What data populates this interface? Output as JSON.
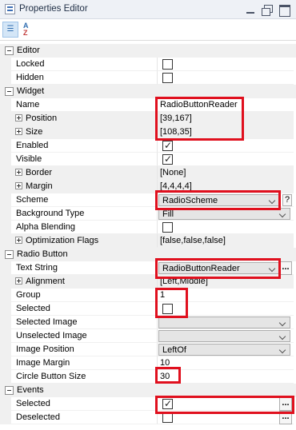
{
  "window": {
    "title": "Properties Editor"
  },
  "toolbar": {
    "categorized_icon": "categorized-sort-icon",
    "alpha_icon": "alphabetical-sort-icon",
    "alpha_glyph_a": "A",
    "alpha_glyph_z": "Z"
  },
  "categories": {
    "editor": "Editor",
    "widget": "Widget",
    "radio_button": "Radio Button",
    "events": "Events"
  },
  "props": {
    "locked": {
      "label": "Locked",
      "checked": false
    },
    "hidden": {
      "label": "Hidden",
      "checked": false
    },
    "name": {
      "label": "Name",
      "value": "RadioButtonReader"
    },
    "position": {
      "label": "Position",
      "value": "[39,167]"
    },
    "size": {
      "label": "Size",
      "value": "[108,35]"
    },
    "enabled": {
      "label": "Enabled",
      "checked": true
    },
    "visible": {
      "label": "Visible",
      "checked": true
    },
    "border": {
      "label": "Border",
      "value": "[None]"
    },
    "margin": {
      "label": "Margin",
      "value": "[4,4,4,4]"
    },
    "scheme": {
      "label": "Scheme",
      "value": "RadioScheme",
      "button": "?"
    },
    "background_type": {
      "label": "Background Type",
      "value": "Fill"
    },
    "alpha_blending": {
      "label": "Alpha Blending",
      "checked": false
    },
    "optimization_flags": {
      "label": "Optimization Flags",
      "value": "[false,false,false]"
    },
    "text_string": {
      "label": "Text String",
      "value": "RadioButtonReader",
      "button": "..."
    },
    "alignment": {
      "label": "Alignment",
      "value": "[Left,Middle]"
    },
    "group": {
      "label": "Group",
      "value": "1"
    },
    "selected_prop": {
      "label": "Selected",
      "checked": false
    },
    "selected_image": {
      "label": "Selected Image",
      "value": ""
    },
    "unselected_image": {
      "label": "Unselected Image",
      "value": ""
    },
    "image_position": {
      "label": "Image Position",
      "value": "LeftOf"
    },
    "image_margin": {
      "label": "Image Margin",
      "value": "10"
    },
    "circle_button_size": {
      "label": "Circle Button Size",
      "value": "30"
    },
    "evt_selected": {
      "label": "Selected",
      "checked": true,
      "button": "..."
    },
    "evt_deselected": {
      "label": "Deselected",
      "checked": false,
      "button": "..."
    }
  },
  "highlight_color": "#e0101e"
}
